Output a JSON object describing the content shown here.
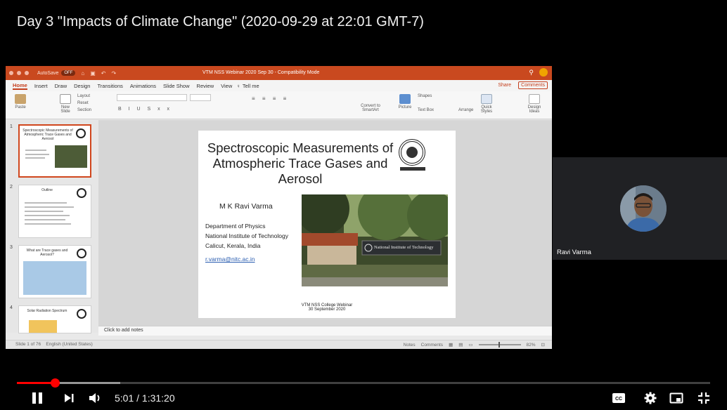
{
  "video": {
    "title": "Day 3 \"Impacts of Climate Change\" (2020-09-29 at 22:01 GMT-7)",
    "current_time": "5:01 / 1:31:20",
    "progress": 0.055,
    "buffered": 0.149
  },
  "powerpoint": {
    "autosave_label": "AutoSave",
    "autosave_state": "OFF",
    "document_title": "VTM NSS Webinar 2020 Sep 30  -  Compatibility Mode",
    "tabs": [
      "Home",
      "Insert",
      "Draw",
      "Design",
      "Transitions",
      "Animations",
      "Slide Show",
      "Review",
      "View"
    ],
    "tell_me": "Tell me",
    "share": "Share",
    "comments": "Comments",
    "ribbon": {
      "paste": "Paste",
      "new_slide": "New Slide",
      "layout": "Layout",
      "reset": "Reset",
      "section": "Section",
      "convert_smartart": "Convert to SmartArt",
      "picture": "Picture",
      "shapes": "Shapes",
      "text_box": "Text Box",
      "arrange": "Arrange",
      "quick_styles": "Quick Styles",
      "design_ideas": "Design Ideas"
    },
    "thumbnails": [
      {
        "num": "1",
        "title": "Spectroscopic Measurements of Atmospheric Trace Gases and Aerosol"
      },
      {
        "num": "2",
        "title": "Outline"
      },
      {
        "num": "3",
        "title": "What are Trace gases and Aerosol?"
      },
      {
        "num": "4",
        "title": "Solar Radiation Spectrum"
      }
    ],
    "notes_placeholder": "Click to add notes",
    "status": {
      "slide_info": "Slide 1 of 76",
      "language": "English (United States)",
      "notes": "Notes",
      "comments": "Comments",
      "zoom": "82%"
    },
    "slide": {
      "title": "Spectroscopic Measurements of Atmospheric Trace Gases and Aerosol",
      "author": "M K Ravi Varma",
      "department": "Department of Physics",
      "institute": "National Institute of Technology",
      "location": "Calicut, Kerala, India",
      "email": "r.varma@nitc.ac.in",
      "sign_text": "National Institute of Technology",
      "footer_line1": "VTM NSS College Webinar",
      "footer_line2": "30 September 2020"
    }
  },
  "participant": {
    "name": "Ravi Varma"
  },
  "colors": {
    "ppt_accent": "#c43e1c",
    "progress": "#ff0000",
    "tile_bg": "#202124"
  }
}
